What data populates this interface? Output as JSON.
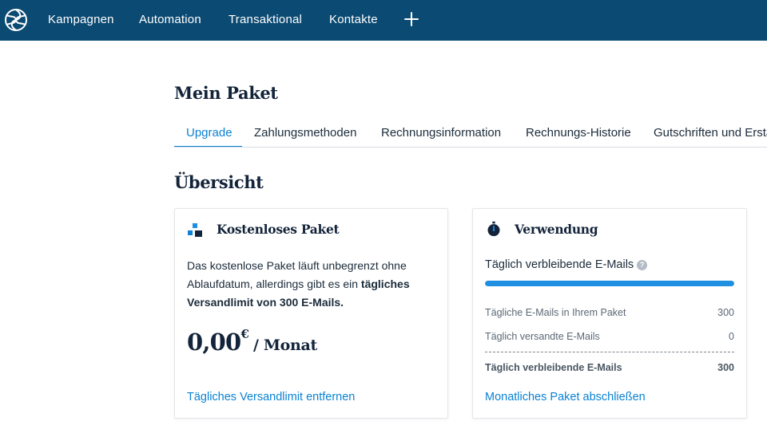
{
  "nav": {
    "items": [
      {
        "label": "Kampagnen"
      },
      {
        "label": "Automation"
      },
      {
        "label": "Transaktional"
      },
      {
        "label": "Kontakte"
      }
    ],
    "add_icon": "plus-icon",
    "logo_icon": "sendinblue-logo-icon"
  },
  "page": {
    "title": "Mein Paket",
    "tabs": [
      {
        "label": "Upgrade",
        "active": true
      },
      {
        "label": "Zahlungsmethoden"
      },
      {
        "label": "Rechnungsinformation"
      },
      {
        "label": "Rechnungs-Historie"
      },
      {
        "label": "Gutschriften und Ersta"
      }
    ],
    "section_title": "Übersicht"
  },
  "free_plan": {
    "icon": "blocks-icon",
    "title": "Kostenloses Paket",
    "desc_part1": "Das kostenlose Paket läuft unbegrenzt ohne Ablaufdatum, allerdings gibt es ein ",
    "desc_bold": "tägliches Versandlimit von 300 E-Mails.",
    "price_amount": "0,00",
    "price_currency": "€",
    "price_period": "/ Monat",
    "link": "Tägliches Versandlimit entfernen"
  },
  "usage": {
    "icon": "stopwatch-icon",
    "title": "Verwendung",
    "remaining_label": "Täglich verbleibende E-Mails",
    "help_icon": "question-mark-icon",
    "progress_fraction": 1.0,
    "rows": [
      {
        "label": "Tägliche E-Mails in Ihrem Paket",
        "value": "300"
      },
      {
        "label": "Täglich versandte E-Mails",
        "value": "0"
      }
    ],
    "total": {
      "label": "Täglich verbleibende E-Mails",
      "value": "300"
    },
    "link": "Monatliches Paket abschließen"
  },
  "colors": {
    "topbar": "#0b4a72",
    "accent": "#0b82d3",
    "progress": "#1e8fe1"
  }
}
